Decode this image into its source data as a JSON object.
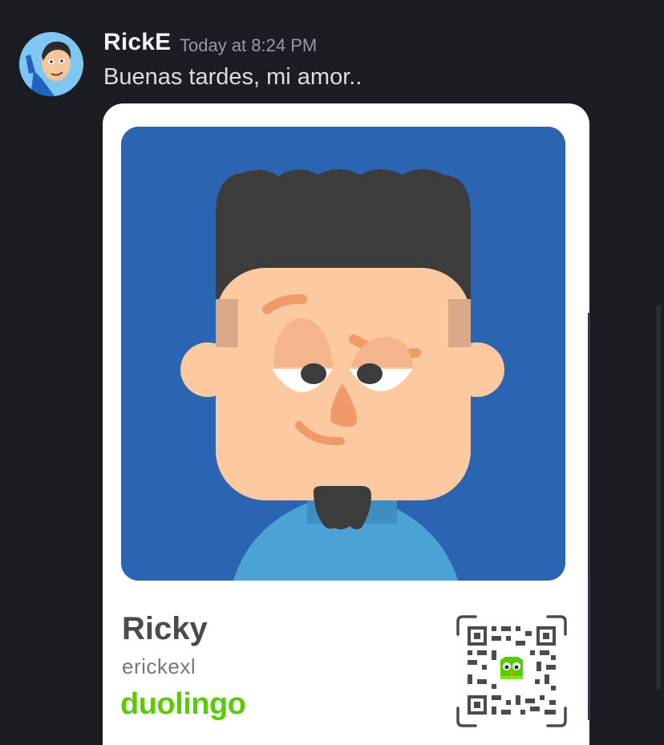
{
  "message": {
    "author": "RickE",
    "timestamp": "Today at 8:24 PM",
    "content": "Buenas tardes, mi amor.."
  },
  "card": {
    "display_name": "Ricky",
    "username": "erickexl",
    "brand": "duolingo"
  },
  "colors": {
    "background": "#1c1d22",
    "author": "#f2f3f5",
    "timestamp": "#949ba4",
    "portrait_bg": "#2b64b0",
    "brand_green": "#58cc02"
  },
  "icons": {
    "avatar": "cartoon-face-avatar",
    "qr": "qr-code-icon",
    "owl": "duo-owl-icon"
  }
}
